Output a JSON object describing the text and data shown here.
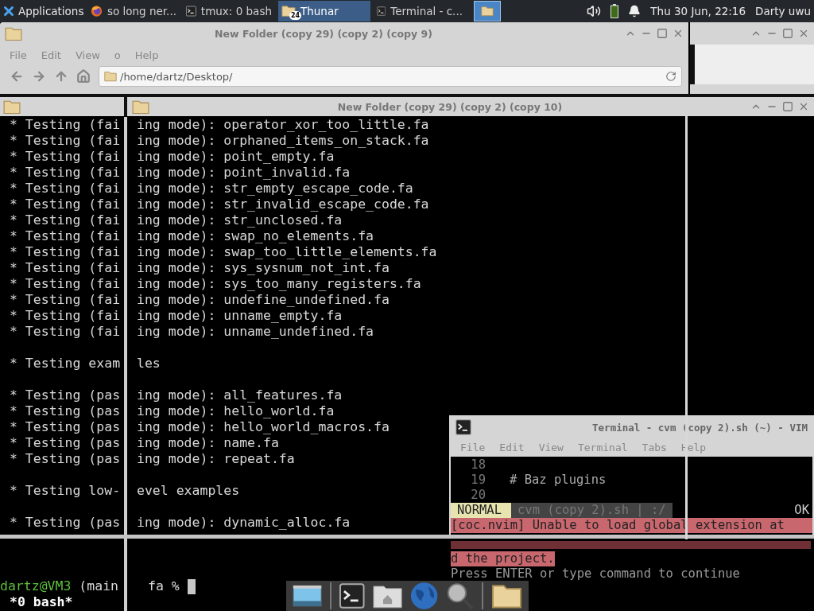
{
  "panel": {
    "menu": "Applications",
    "tasks": [
      {
        "kind": "firefox",
        "label": "so long ner...",
        "selected": false
      },
      {
        "kind": "terminal",
        "label": "tmux: 0 bash",
        "selected": false
      },
      {
        "kind": "folder",
        "label": "Thunar",
        "badge": "24",
        "selected": true
      },
      {
        "kind": "terminal",
        "label": "Terminal - c...",
        "selected": false
      }
    ],
    "workspaces": [
      {
        "selected": true
      }
    ],
    "clock": "Thu 30 Jun, 22:16",
    "user": "Darty uwu"
  },
  "folder_window": {
    "title": "New Folder (copy 29) (copy 2) (copy 9)",
    "menu": [
      "File",
      "Edit",
      "View",
      "o",
      "Help"
    ],
    "path": "/home/dartz/Desktop/"
  },
  "front_folder_window": {
    "title": "New Folder (copy 29) (copy 2) (copy 10)"
  },
  "tmux": {
    "lines": [
      {
        "kind": "text",
        "left": "* Testing (fai",
        "right": "ing mode): operator_xor_too_little.fa"
      },
      {
        "kind": "text",
        "left": "* Testing (fai",
        "right": "ing mode): orphaned_items_on_stack.fa"
      },
      {
        "kind": "text",
        "left": "* Testing (fai",
        "right": "ing mode): point_empty.fa"
      },
      {
        "kind": "text",
        "left": "* Testing (fai",
        "right": "ing mode): point_invalid.fa"
      },
      {
        "kind": "text",
        "left": "* Testing (fai",
        "right": "ing mode): str_empty_escape_code.fa"
      },
      {
        "kind": "text",
        "left": "* Testing (fai",
        "right": "ing mode): str_invalid_escape_code.fa"
      },
      {
        "kind": "text",
        "left": "* Testing (fai",
        "right": "ing mode): str_unclosed.fa"
      },
      {
        "kind": "text",
        "left": "* Testing (fai",
        "right": "ing mode): swap_no_elements.fa"
      },
      {
        "kind": "text",
        "left": "* Testing (fai",
        "right": "ing mode): swap_too_little_elements.fa"
      },
      {
        "kind": "text",
        "left": "* Testing (fai",
        "right": "ing mode): sys_sysnum_not_int.fa"
      },
      {
        "kind": "text",
        "left": "* Testing (fai",
        "right": "ing mode): sys_too_many_registers.fa"
      },
      {
        "kind": "text",
        "left": "* Testing (fai",
        "right": "ing mode): undefine_undefined.fa"
      },
      {
        "kind": "text",
        "left": "* Testing (fai",
        "right": "ing mode): unname_empty.fa"
      },
      {
        "kind": "text",
        "left": "* Testing (fai",
        "right": "ing mode): unname_undefined.fa"
      },
      {
        "kind": "blank"
      },
      {
        "kind": "text",
        "left": "* Testing exam",
        "right": "les"
      },
      {
        "kind": "blank"
      },
      {
        "kind": "text",
        "left": "* Testing (pas",
        "right": "ing mode): all_features.fa"
      },
      {
        "kind": "text",
        "left": "* Testing (pas",
        "right": "ing mode): hello_world.fa"
      },
      {
        "kind": "text",
        "left": "* Testing (pas",
        "right": "ing mode): hello_world_macros.fa"
      },
      {
        "kind": "text",
        "left": "* Testing (pas",
        "right": "ing mode): name.fa"
      },
      {
        "kind": "text",
        "left": "* Testing (pas",
        "right": "ing mode): repeat.fa"
      },
      {
        "kind": "blank"
      },
      {
        "kind": "text",
        "left": "* Testing low-",
        "right": "evel examples"
      },
      {
        "kind": "blank"
      },
      {
        "kind": "text",
        "left": "* Testing (pas",
        "right": "ing mode): dynamic_alloc.fa"
      }
    ],
    "prompt_user": "dartz@VM3",
    "prompt_rest": " (main",
    "prompt_right": "fa %",
    "status": "*0 bash*"
  },
  "vim": {
    "title": "Terminal - cvm (copy 2).sh (~) - VIM",
    "menu": [
      "File",
      "Edit",
      "View",
      "Terminal",
      "Tabs",
      "Help"
    ],
    "lines": [
      {
        "number": "18"
      },
      {
        "number": "19",
        "text": "# Baz plugins"
      },
      {
        "number": "20"
      }
    ],
    "mode": "NORMAL",
    "file": "cvm (copy 2).sh | :/",
    "status_right": "OK",
    "error": "[coc.nvim] Unable to load global extension at",
    "error_tail": "d the project.",
    "prompt": "Press ENTER or type command to continue"
  },
  "dock": [
    {
      "kind": "desktop"
    },
    {
      "kind": "terminal"
    },
    {
      "kind": "home"
    },
    {
      "kind": "globe"
    },
    {
      "kind": "search"
    },
    {
      "kind": "folder"
    }
  ]
}
